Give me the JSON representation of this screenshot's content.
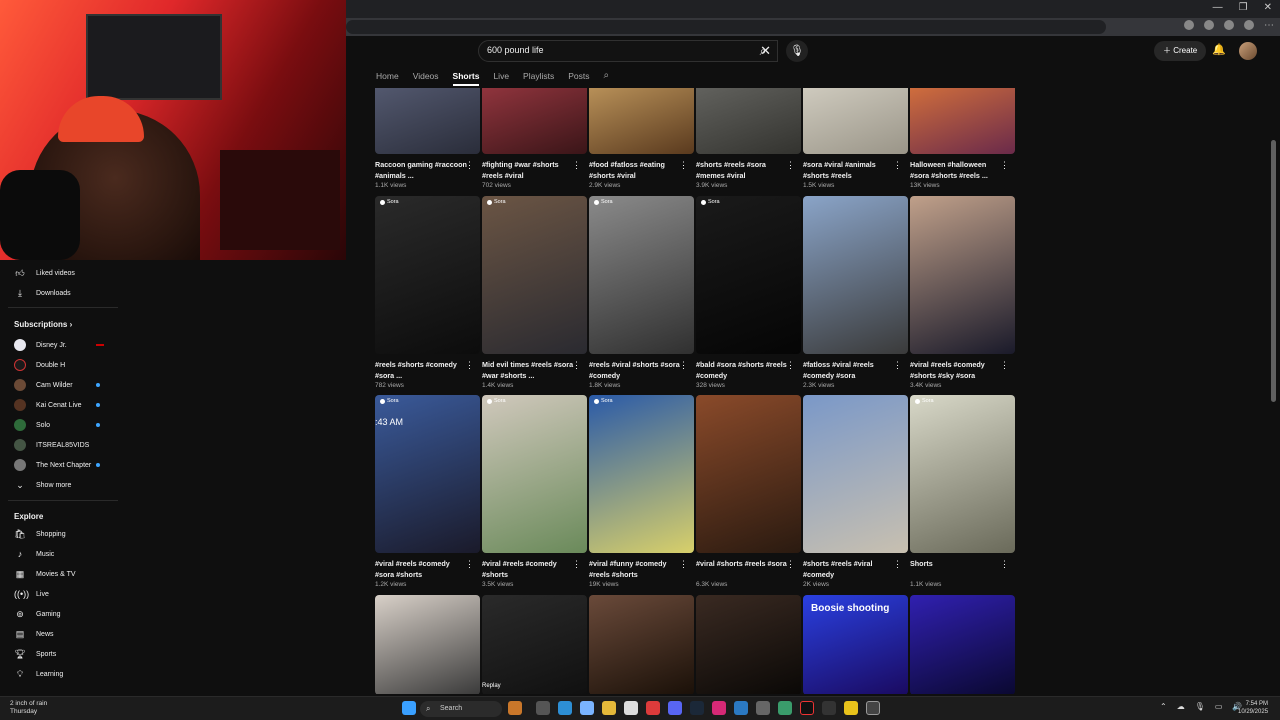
{
  "colors": {
    "bg": "#0f0f0f",
    "accent_blue": "#3ea6ff",
    "text_secondary": "#aaaaaa"
  },
  "header": {
    "search_query": "600 pound life",
    "create_label": "Create"
  },
  "tabs": [
    {
      "label": "Home"
    },
    {
      "label": "Videos"
    },
    {
      "label": "Shorts",
      "active": true
    },
    {
      "label": "Live"
    },
    {
      "label": "Playlists"
    },
    {
      "label": "Posts"
    }
  ],
  "sidebar": {
    "top_items": [
      {
        "label": "Liked videos",
        "icon": "thumbs-up-icon"
      },
      {
        "label": "Downloads",
        "icon": "download-icon"
      }
    ],
    "subscriptions_heading": "Subscriptions",
    "subscriptions": [
      {
        "label": "Disney Jr.",
        "live": true
      },
      {
        "label": "Double H"
      },
      {
        "label": "Cam Wilder"
      },
      {
        "label": "Kai Cenat Live"
      },
      {
        "label": "Solo"
      },
      {
        "label": "ITSREAL85VIDS"
      },
      {
        "label": "The Next Chapter"
      }
    ],
    "show_more": "Show more",
    "explore_heading": "Explore",
    "explore_items": [
      {
        "label": "Shopping",
        "icon": "shopping-bag-icon"
      },
      {
        "label": "Music",
        "icon": "music-note-icon"
      },
      {
        "label": "Movies & TV",
        "icon": "film-icon"
      },
      {
        "label": "Live",
        "icon": "live-icon"
      },
      {
        "label": "Gaming",
        "icon": "gaming-controller-icon"
      },
      {
        "label": "News",
        "icon": "news-icon"
      },
      {
        "label": "Sports",
        "icon": "trophy-icon"
      },
      {
        "label": "Learning",
        "icon": "lightbulb-icon"
      }
    ]
  },
  "shorts": [
    {
      "title": "Raccoon gaming #raccoon #animals ...",
      "views": "1.1K views"
    },
    {
      "title": "#fighting #war #shorts #reels #viral",
      "views": "702 views"
    },
    {
      "title": "#food #fatloss #eating #shorts #viral",
      "views": "2.9K views"
    },
    {
      "title": "#shorts #reels #sora #memes #viral",
      "views": "3.9K views"
    },
    {
      "title": "#sora #viral #animals #shorts #reels",
      "views": "1.5K views"
    },
    {
      "title": "Halloween #halloween #sora #shorts #reels ...",
      "views": "13K views"
    },
    {
      "title": "#reels #shorts #comedy #sora ...",
      "views": "782 views"
    },
    {
      "title": "Mid evil times #reels #sora #war #shorts ...",
      "views": "1.4K views"
    },
    {
      "title": "#reels #viral #shorts #sora #comedy",
      "views": "1.8K views"
    },
    {
      "title": "#bald #sora #shorts #reels #comedy",
      "views": "328 views"
    },
    {
      "title": "#fatloss #viral #reels #comedy #sora",
      "views": "2.3K views"
    },
    {
      "title": "#viral #reels #comedy #shorts #sky #sora",
      "views": "3.4K views"
    },
    {
      "title": "#viral #reels #comedy #sora #shorts",
      "views": "1.2K views"
    },
    {
      "title": "#viral #reels #comedy #shorts",
      "views": "3.5K views"
    },
    {
      "title": "#viral #funny #comedy #reels #shorts",
      "views": "19K views"
    },
    {
      "title": "#viral #shorts #reels #sora",
      "views": "6.3K views"
    },
    {
      "title": "#shorts #reels #viral #comedy",
      "views": "2K views"
    },
    {
      "title": "Shorts",
      "views": "1.1K views"
    }
  ],
  "thumb_badges": {
    "sora": "Sora",
    "replay": "Replay",
    "overlay_boosie": "Boosie shooting",
    "overlay_time": ":43 AM"
  },
  "taskbar": {
    "weather_line1": "2 inch of rain",
    "weather_line2": "Thursday",
    "search_label": "Search",
    "time": "7:54 PM",
    "date": "10/29/2025"
  }
}
